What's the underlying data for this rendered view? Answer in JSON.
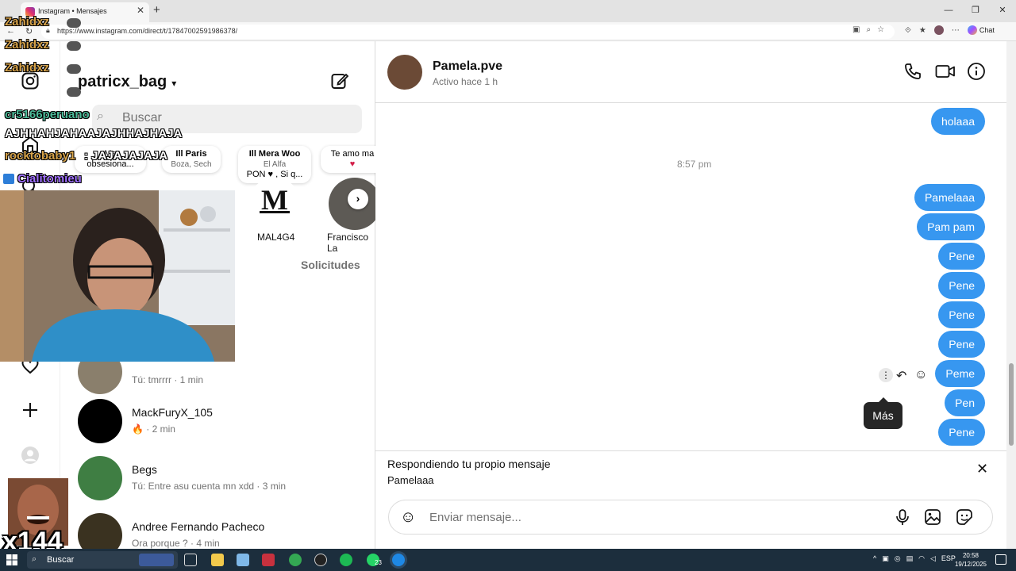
{
  "browser": {
    "tab_title": "Instagram • Mensajes",
    "tab_close": "✕",
    "new_tab": "+",
    "url": "https://www.instagram.com/direct/t/17847002591986378/",
    "chat_label": "Chat",
    "window_buttons": [
      "—",
      "❐",
      "✕"
    ]
  },
  "inbox": {
    "username": "patricx_bag",
    "search_placeholder": "Buscar",
    "notes": [
      {
        "text": "Me obsesiona...",
        "sub": ""
      },
      {
        "text": "Ill Paris",
        "sub": "Boza, Sech"
      },
      {
        "text": "Ill Mera Woo",
        "sub": "El Alfa",
        "extra": "PON ♥ , Si q..."
      },
      {
        "text": "Te amo ma",
        "sub": "♥"
      }
    ],
    "stories": [
      {
        "name": "MAL4G4"
      },
      {
        "name": "Francisco La"
      }
    ],
    "requests_label": "Solicitudes",
    "conversations": [
      {
        "name": "",
        "meta": "Tú: tmrrrr · 1 min"
      },
      {
        "name": "MackFuryX_105",
        "meta": "🔥 · 2 min"
      },
      {
        "name": "Begs",
        "meta": "Tú: Entre asu cuenta mn xdd · 3 min"
      },
      {
        "name": "Andree Fernando Pacheco",
        "meta": "Ora porque ? · 4 min"
      }
    ]
  },
  "chat": {
    "name": "Pamela.pve",
    "status": "Activo hace 1 h",
    "timestamp": "8:57 pm",
    "messages": [
      "holaaa",
      "Pamelaaa",
      "Pam pam",
      "Pene",
      "Pene",
      "Pene",
      "Pene",
      "Peme",
      "Pen",
      "Pene"
    ],
    "tooltip": "Más",
    "reply_title": "Respondiendo tu propio mensaje",
    "reply_message": "Pamelaaa",
    "reply_close": "✕",
    "composer_placeholder": "Enviar mensaje..."
  },
  "overlay": {
    "chat_lines": [
      {
        "user": "Zahidxz",
        "text": ""
      },
      {
        "user": "Zahidxz",
        "text": ""
      },
      {
        "user": "Zahidxz",
        "text": ""
      },
      {
        "user": "cr5166peruano",
        "text": ""
      },
      {
        "user": "",
        "text": "AJHHAHJAHAAJAJHHAJHAJA"
      },
      {
        "user": "rocktobaby1",
        "text": ": JAJAJAJAJA"
      },
      {
        "user": "Cialitomieu",
        "text": ""
      }
    ],
    "counter": "x144"
  },
  "taskbar": {
    "search_label": "Buscar",
    "tray_lang": "ESP",
    "time": "20:58",
    "date": "19/12/2025",
    "whatsapp_badge": "23"
  }
}
